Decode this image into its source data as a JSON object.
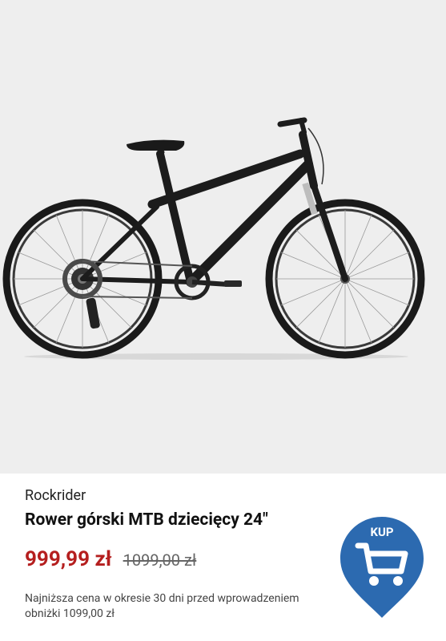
{
  "product": {
    "image_alt": "Rower górski MTB dziecięcy 24\"",
    "brand": "Rockrider",
    "title": "Rower górski MTB dziecięcy 24\"",
    "price": "999,99 zł",
    "old_price": "1099,00 zł",
    "lowest_price_note": "Najniższa cena w okresie 30 dni przed wprowadzeniem obniżki 1099,00 zł"
  },
  "buy_button": {
    "label": "KUP",
    "icon": "cart-icon",
    "color": "#2c6ab0"
  },
  "colors": {
    "price": "#b51f1f",
    "image_background": "#eeeeee"
  }
}
